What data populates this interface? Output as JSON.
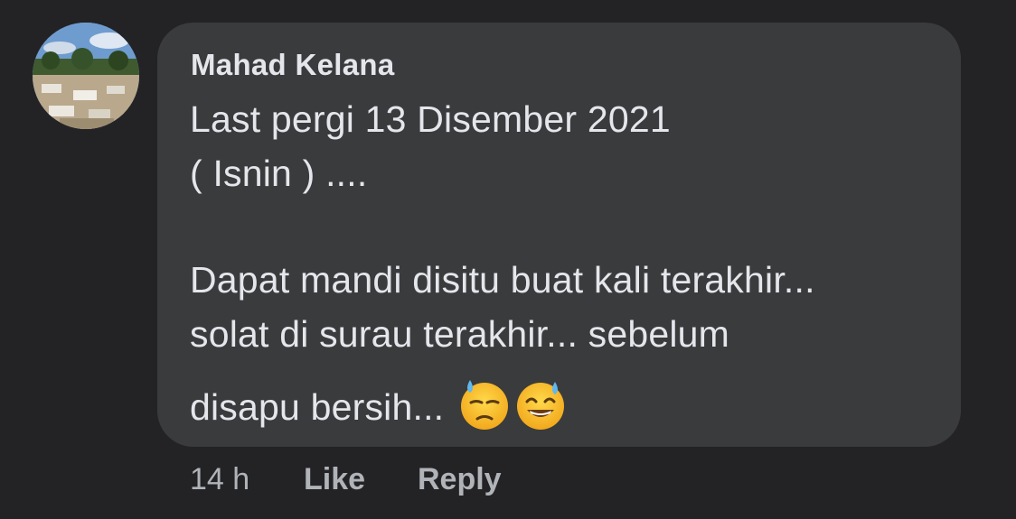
{
  "comment": {
    "author": "Mahad Kelana",
    "lines": [
      "Last pergi 13 Disember 2021",
      "( Isnin ) ....",
      "Dapat mandi disitu buat kali terakhir...",
      "solat di surau terakhir... sebelum",
      "disapu bersih..."
    ],
    "emojis": [
      "downcast-face-with-sweat-icon",
      "grinning-face-with-sweat-icon"
    ]
  },
  "actions": {
    "time": "14 h",
    "like_label": "Like",
    "reply_label": "Reply"
  },
  "colors": {
    "background": "#232325",
    "bubble": "#3a3b3c",
    "text": "#e4e6eb",
    "secondary_text": "#b0b3b8"
  }
}
